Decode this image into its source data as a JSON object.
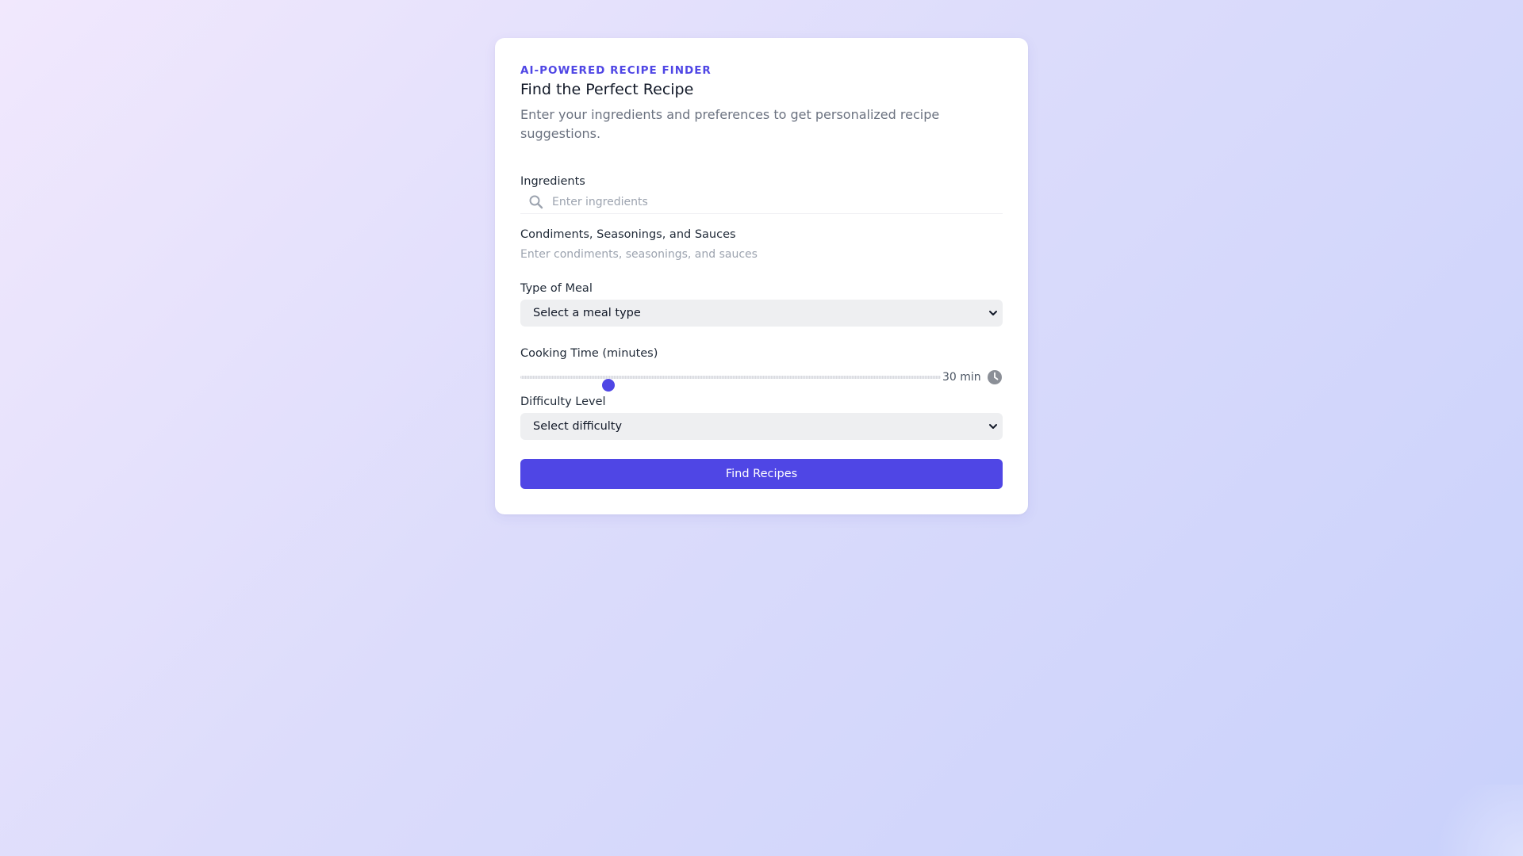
{
  "header": {
    "eyebrow": "AI-POWERED RECIPE FINDER",
    "title": "Find the Perfect Recipe",
    "subtitle": "Enter your ingredients and preferences to get personalized recipe suggestions."
  },
  "ingredients": {
    "label": "Ingredients",
    "placeholder": "Enter ingredients",
    "value": "",
    "icon": "search-icon"
  },
  "condiments": {
    "label": "Condiments, Seasonings, and Sauces",
    "placeholder": "Enter condiments, seasonings, and sauces",
    "value": ""
  },
  "meal_type": {
    "label": "Type of Meal",
    "selected": "Select a meal type"
  },
  "cooking_time": {
    "label": "Cooking Time (minutes)",
    "value": 30,
    "display": "30 min",
    "fraction": 0.21,
    "icon": "clock-icon"
  },
  "difficulty": {
    "label": "Difficulty Level",
    "selected": "Select difficulty"
  },
  "submit": {
    "label": "Find Recipes"
  },
  "colors": {
    "accent": "#4f46e5",
    "heading": "#111827",
    "muted": "#6b7280",
    "select_bg": "#eeeff1"
  }
}
